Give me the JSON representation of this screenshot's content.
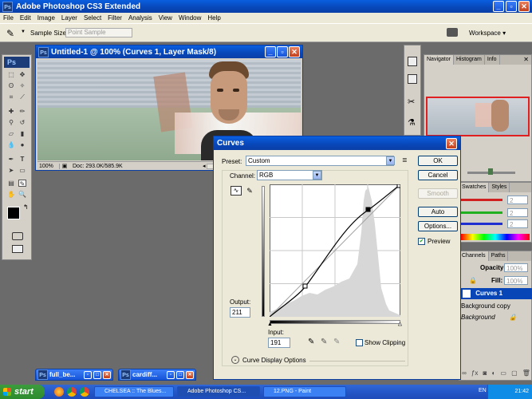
{
  "app": {
    "title": "Adobe Photoshop CS3 Extended",
    "logo": "Ps"
  },
  "menu": [
    "File",
    "Edit",
    "Image",
    "Layer",
    "Select",
    "Filter",
    "Analysis",
    "View",
    "Window",
    "Help"
  ],
  "options": {
    "sample_size_label": "Sample Size:",
    "sample_size_value": "Point Sample",
    "workspace_label": "Workspace"
  },
  "document": {
    "title": "Untitled-1 @ 100% (Curves 1, Layer Mask/8)",
    "zoom": "100%",
    "doc_info": "Doc: 293.0K/585.9K"
  },
  "navigator": {
    "tabs": [
      "Navigator",
      "Histogram",
      "Info"
    ]
  },
  "swatches": {
    "tabs": [
      "Swatches",
      "Styles"
    ],
    "values": [
      "2",
      "2",
      "2"
    ]
  },
  "layers": {
    "tabs": [
      "Channels",
      "Paths"
    ],
    "opacity_label": "Opacity:",
    "opacity_value": "100%",
    "fill_label": "Fill:",
    "fill_value": "100%",
    "items": [
      "Curves 1",
      "Background copy",
      "Background"
    ]
  },
  "curves": {
    "title": "Curves",
    "preset_label": "Preset:",
    "preset_value": "Custom",
    "channel_label": "Channel:",
    "channel_value": "RGB",
    "output_label": "Output:",
    "output_value": "211",
    "input_label": "Input:",
    "input_value": "191",
    "show_clipping": "Show Clipping",
    "display_options": "Curve Display Options",
    "buttons": {
      "ok": "OK",
      "cancel": "Cancel",
      "smooth": "Smooth",
      "auto": "Auto",
      "options": "Options..."
    },
    "preview_label": "Preview",
    "preview_checked": true
  },
  "minimized": [
    "full_be...",
    "cardiff..."
  ],
  "taskbar": {
    "start": "start",
    "tasks": [
      "CHELSEA :: The Blues...",
      "Adobe Photoshop CS...",
      "12.PNG - Paint"
    ],
    "lang": "EN",
    "clock": "21:42"
  },
  "colors": {
    "xp_blue": "#0846b8",
    "dialog_bg": "#ece9d8",
    "panel_bg": "#d4d0c8",
    "workspace": "#6b6b6b"
  }
}
